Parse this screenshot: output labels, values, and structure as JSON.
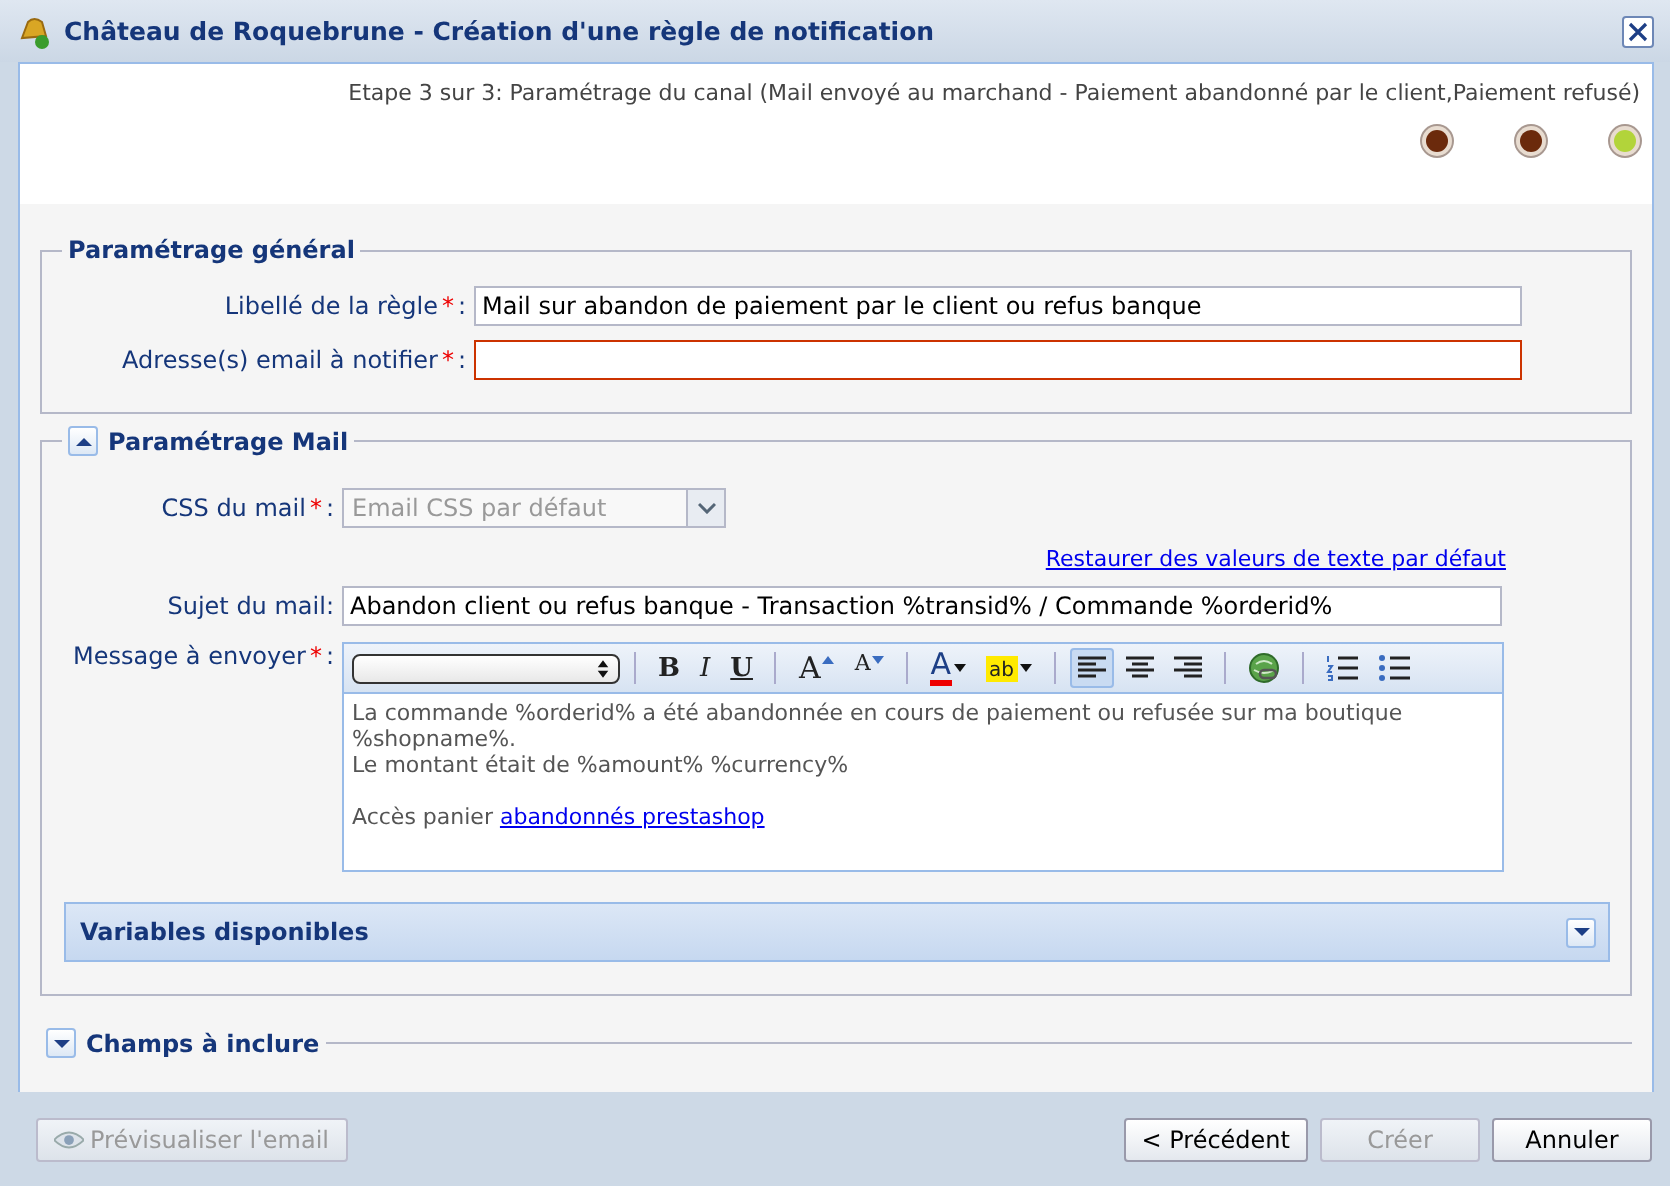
{
  "window": {
    "title": "Château de Roquebrune - Création d'une règle de notification"
  },
  "step": {
    "text": "Etape 3 sur 3: Paramétrage du canal (Mail envoyé au marchand - Paiement abandonné par le client,Paiement refusé)",
    "dots": [
      {
        "color": "#6b2a0c"
      },
      {
        "color": "#6b2a0c"
      },
      {
        "color": "#b2d43a"
      }
    ]
  },
  "general": {
    "title": "Paramétrage général",
    "fields": [
      {
        "label": "Libellé de la règle",
        "required_mark": "*",
        "colon": ":",
        "value": "Mail sur abandon de paiement par le client ou refus banque",
        "invalid": false
      },
      {
        "label": "Adresse(s) email à notifier",
        "required_mark": "*",
        "colon": ":",
        "invalid": true
      }
    ]
  },
  "mail": {
    "title": "Paramétrage Mail",
    "expanded": true,
    "css": {
      "label": "CSS du mail",
      "required_mark": "*",
      "colon": ":",
      "value": "Email CSS par défaut",
      "disabled": true
    },
    "restore_link": "Restaurer des valeurs de texte par défaut",
    "subject": {
      "label": "Sujet du mail",
      "colon": ":",
      "value": "Abandon client ou refus banque - Transaction %transid% / Commande %orderid%"
    },
    "message": {
      "label": "Message à envoyer",
      "required_mark": "*",
      "colon": ":",
      "toolbar": [
        {
          "kind": "select"
        },
        {
          "kind": "sep"
        },
        {
          "kind": "bold",
          "label": "B"
        },
        {
          "kind": "italic",
          "label": "I"
        },
        {
          "kind": "underline",
          "label": "U"
        },
        {
          "kind": "sep"
        },
        {
          "kind": "grow",
          "label": "A"
        },
        {
          "kind": "shrink",
          "label": "A"
        },
        {
          "kind": "sep"
        },
        {
          "kind": "forecolor",
          "label": "A"
        },
        {
          "kind": "backcolor",
          "label": "ab"
        },
        {
          "kind": "sep"
        },
        {
          "kind": "align-left",
          "selected": true
        },
        {
          "kind": "align-center",
          "selected": false
        },
        {
          "kind": "align-right",
          "selected": false
        },
        {
          "kind": "sep"
        },
        {
          "kind": "link"
        },
        {
          "kind": "sep"
        },
        {
          "kind": "ordered-list"
        },
        {
          "kind": "bullet-list"
        }
      ],
      "paragraphs": [
        {
          "lines": [
            "La commande %orderid% a été abandonnée en cours de paiement ou refusée sur ma boutique",
            "%shopname%.",
            "Le montant était de %amount% %currency%"
          ]
        },
        {
          "lines": [
            "Accès panier "
          ],
          "link": "abandonnés prestashop"
        }
      ]
    },
    "variables": {
      "title": "Variables disponibles",
      "expanded": false
    }
  },
  "fields_section": {
    "title": "Champs à inclure",
    "expanded": false
  },
  "buttons": [
    {
      "label": "Prévisualiser l'email",
      "disabled": true,
      "kind": "preview"
    },
    {
      "label": "< Précédent",
      "disabled": false,
      "kind": "plain"
    },
    {
      "label": "Créer",
      "disabled": true,
      "kind": "plain"
    },
    {
      "label": "Annuler",
      "disabled": false,
      "kind": "plain"
    }
  ]
}
